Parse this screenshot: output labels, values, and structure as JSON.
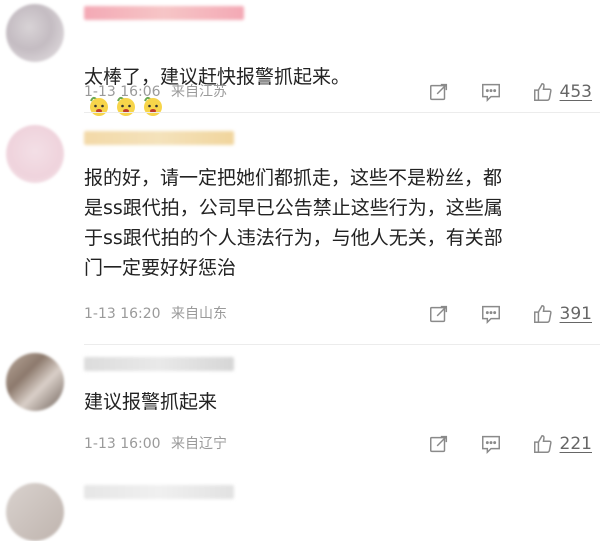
{
  "comments": [
    {
      "text": "太棒了，建议赶快报警抓起来。",
      "emoji_name": "melon-eater-face",
      "emoji_count": 3,
      "time": "1-13 16:06",
      "location": "来自江苏",
      "likes": "453"
    },
    {
      "text": "报的好，请一定把她们都抓走，这些不是粉丝，都\n是ss跟代拍，公司早已公告禁止这些行为，这些属\n于ss跟代拍的个人违法行为，与他人无关，有关部\n门一定要好好惩治",
      "time": "1-13 16:20",
      "location": "来自山东",
      "likes": "391"
    },
    {
      "text": "建议报警抓起来",
      "time": "1-13 16:00",
      "location": "来自辽宁",
      "likes": "221"
    }
  ],
  "icons": {
    "share": "share-icon",
    "comment": "comment-icon",
    "like": "thumbs-up-icon"
  },
  "colors": {
    "meta_text": "#9a9a9a",
    "icon": "#8a8a8a"
  }
}
